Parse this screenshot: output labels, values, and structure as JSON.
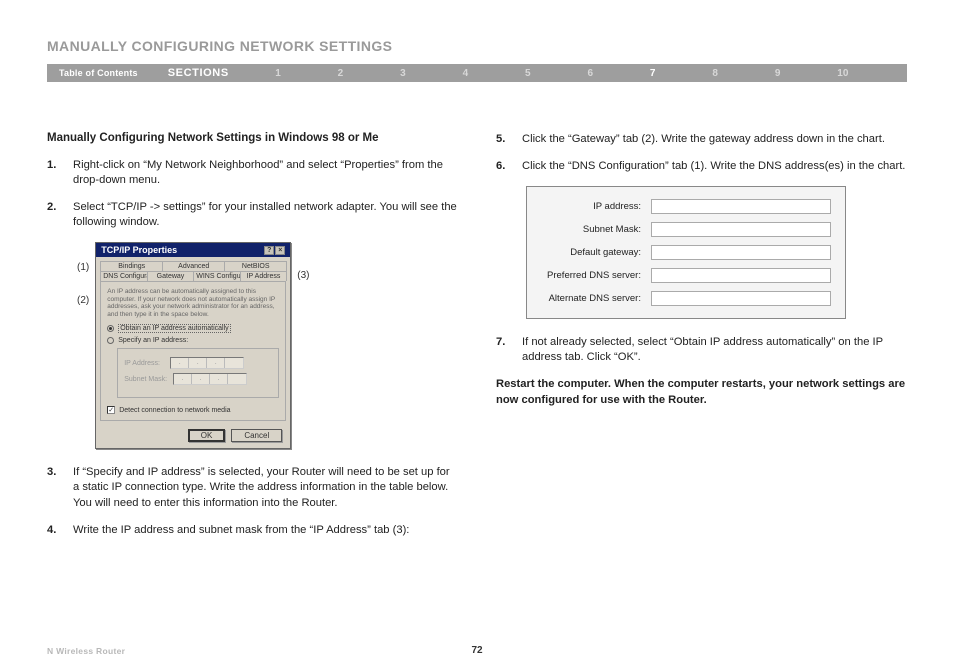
{
  "page_title": "MANUALLY CONFIGURING NETWORK SETTINGS",
  "nav": {
    "toc": "Table of Contents",
    "sections": "SECTIONS",
    "nums": [
      "1",
      "2",
      "3",
      "4",
      "5",
      "6",
      "7",
      "8",
      "9",
      "10"
    ],
    "active": "7"
  },
  "subheading": "Manually Configuring Network Settings in Windows 98 or Me",
  "steps_left": [
    {
      "n": "1.",
      "t": "Right-click on “My Network Neighborhood” and select “Properties” from the drop-down menu."
    },
    {
      "n": "2.",
      "t": "Select “TCP/IP -> settings” for your installed network adapter. You will see the following window."
    },
    {
      "n": "3.",
      "t": "If “Specify and IP address” is selected, your Router will need to be set up for a static IP connection type. Write the address information in the table below. You will need to enter this information into the Router."
    },
    {
      "n": "4.",
      "t": "Write the IP address and subnet mask from the “IP Address” tab (3):"
    }
  ],
  "steps_right": [
    {
      "n": "5.",
      "t": "Click the “Gateway” tab (2). Write the gateway address down in the chart."
    },
    {
      "n": "6.",
      "t": "Click the “DNS Configuration” tab (1). Write the DNS address(es) in the chart."
    },
    {
      "n": "7.",
      "t": "If not already selected, select “Obtain IP address automatically” on the IP address tab. Click “OK”."
    }
  ],
  "restart": "Restart the computer. When the computer restarts, your network settings are now configured for use with the Router.",
  "callouts": {
    "c1": "(1)",
    "c2": "(2)",
    "c3": "(3)"
  },
  "dialog": {
    "title": "TCP/IP Properties",
    "tabs_row1": [
      "Bindings",
      "Advanced",
      "NetBIOS"
    ],
    "tabs_row2": [
      "DNS Configuration",
      "Gateway",
      "WINS Configuration",
      "IP Address"
    ],
    "body_text": "An IP address can be automatically assigned to this computer. If your network does not automatically assign IP addresses, ask your network administrator for an address, and then type it in the space below.",
    "radio_auto": "Obtain an IP address automatically",
    "radio_spec": "Specify an IP address:",
    "ip_label": "IP Address:",
    "mask_label": "Subnet Mask:",
    "detect": "Detect connection to network media",
    "ok": "OK",
    "cancel": "Cancel"
  },
  "form": {
    "rows": [
      "IP address:",
      "Subnet Mask:",
      "Default gateway:",
      "Preferred DNS server:",
      "Alternate DNS server:"
    ]
  },
  "footer": {
    "product": "N Wireless Router",
    "page": "72"
  }
}
